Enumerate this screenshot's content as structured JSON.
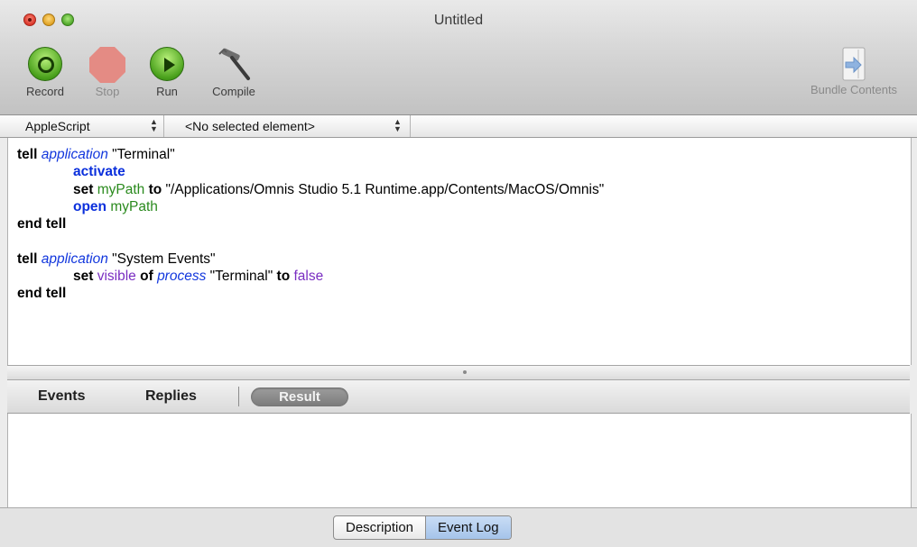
{
  "window": {
    "title": "Untitled"
  },
  "toolbar": {
    "record_label": "Record",
    "stop_label": "Stop",
    "run_label": "Run",
    "compile_label": "Compile",
    "bundle_label": "Bundle Contents"
  },
  "navbar": {
    "language": "AppleScript",
    "element": "<No selected element>"
  },
  "script": {
    "l1a": "tell",
    "l1b": "application",
    "l1c": "\"Terminal\"",
    "l2": "activate",
    "l3a": "set",
    "l3b": "myPath",
    "l3c": "to",
    "l3d": "\"/Applications/Omnis Studio 5.1 Runtime.app/Contents/MacOS/Omnis\"",
    "l4a": "open",
    "l4b": "myPath",
    "l5": "end tell",
    "l7a": "tell",
    "l7b": "application",
    "l7c": "\"System Events\"",
    "l8a": "set",
    "l8b": "visible",
    "l8c": "of",
    "l8d": "process",
    "l8e": "\"Terminal\"",
    "l8f": "to",
    "l8g": "false",
    "l9": "end tell"
  },
  "result_tabs": {
    "events": "Events",
    "replies": "Replies",
    "result": "Result"
  },
  "bottom": {
    "description": "Description",
    "event_log": "Event Log"
  }
}
